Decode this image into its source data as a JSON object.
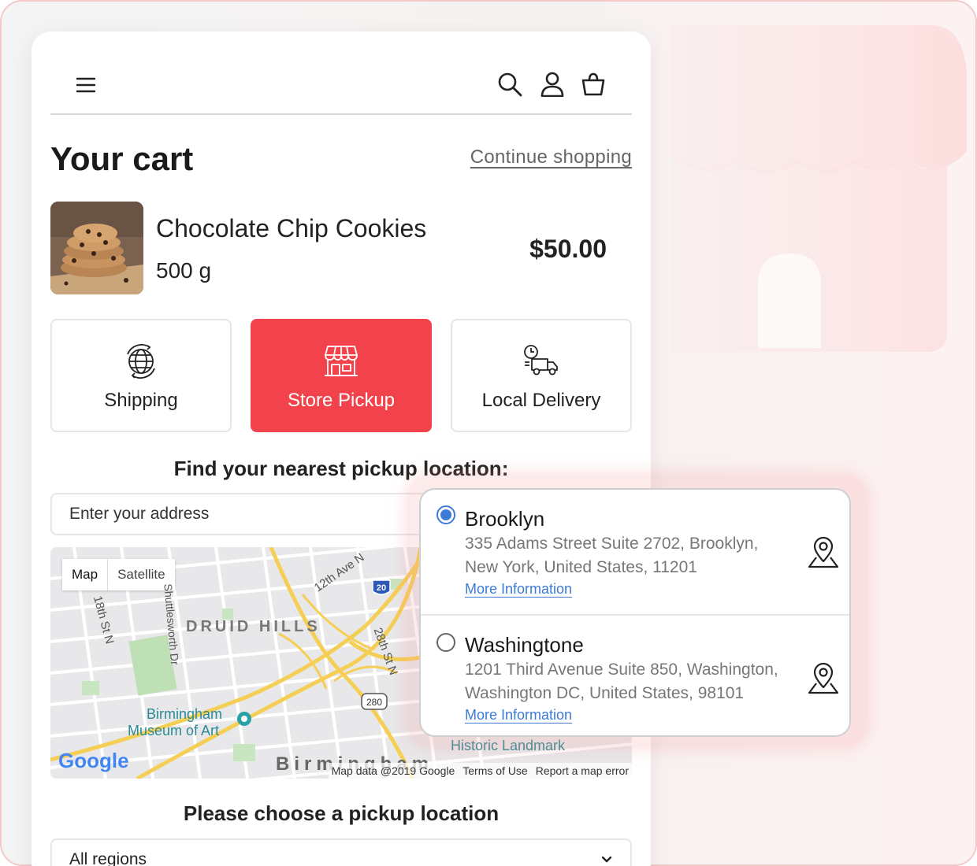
{
  "header": {
    "menu_icon": "hamburger-icon",
    "search_icon": "search-icon",
    "account_icon": "user-icon",
    "cart_icon": "shopping-bag-icon"
  },
  "cart": {
    "title": "Your cart",
    "continue_label": "Continue shopping"
  },
  "product": {
    "name": "Chocolate Chip Cookies",
    "weight": "500 g",
    "price": "$50.00"
  },
  "delivery_methods": [
    {
      "label": "Shipping",
      "icon": "globe-icon",
      "active": false
    },
    {
      "label": "Store Pickup",
      "icon": "storefront-icon",
      "active": true
    },
    {
      "label": "Local Delivery",
      "icon": "delivery-truck-icon",
      "active": false
    }
  ],
  "pickup": {
    "find_title": "Find your nearest pickup location:",
    "address_placeholder": "Enter your address",
    "choose_title": "Please choose a pickup location",
    "region_value": "All regions"
  },
  "map": {
    "tabs": [
      "Map",
      "Satellite"
    ],
    "labels": [
      "DRUID HILLS",
      "12th Ave N",
      "18th St N",
      "Shuttlesworth Dr",
      "28th St N",
      "Birmingham",
      "Museum of Art",
      "Historic Landmark",
      "Birmingham",
      "20",
      "280"
    ],
    "google_logo": "Google",
    "footer": [
      "Map data @2019 Google",
      "Terms of Use",
      "Report a map error"
    ]
  },
  "locations": [
    {
      "name": "Brooklyn",
      "address_line1": "335 Adams Street Suite 2702, Brooklyn,",
      "address_line2": "New York, United States, 11201",
      "more_label": "More Information",
      "selected": true
    },
    {
      "name": "Washingtone",
      "address_line1": "1201 Third Avenue Suite 850, Washington,",
      "address_line2": "Washington DC, United States, 98101",
      "more_label": "More Information",
      "selected": false
    }
  ],
  "colors": {
    "accent": "#f2434c",
    "link": "#3e7bd6",
    "frame_border": "#f3c9c9"
  }
}
